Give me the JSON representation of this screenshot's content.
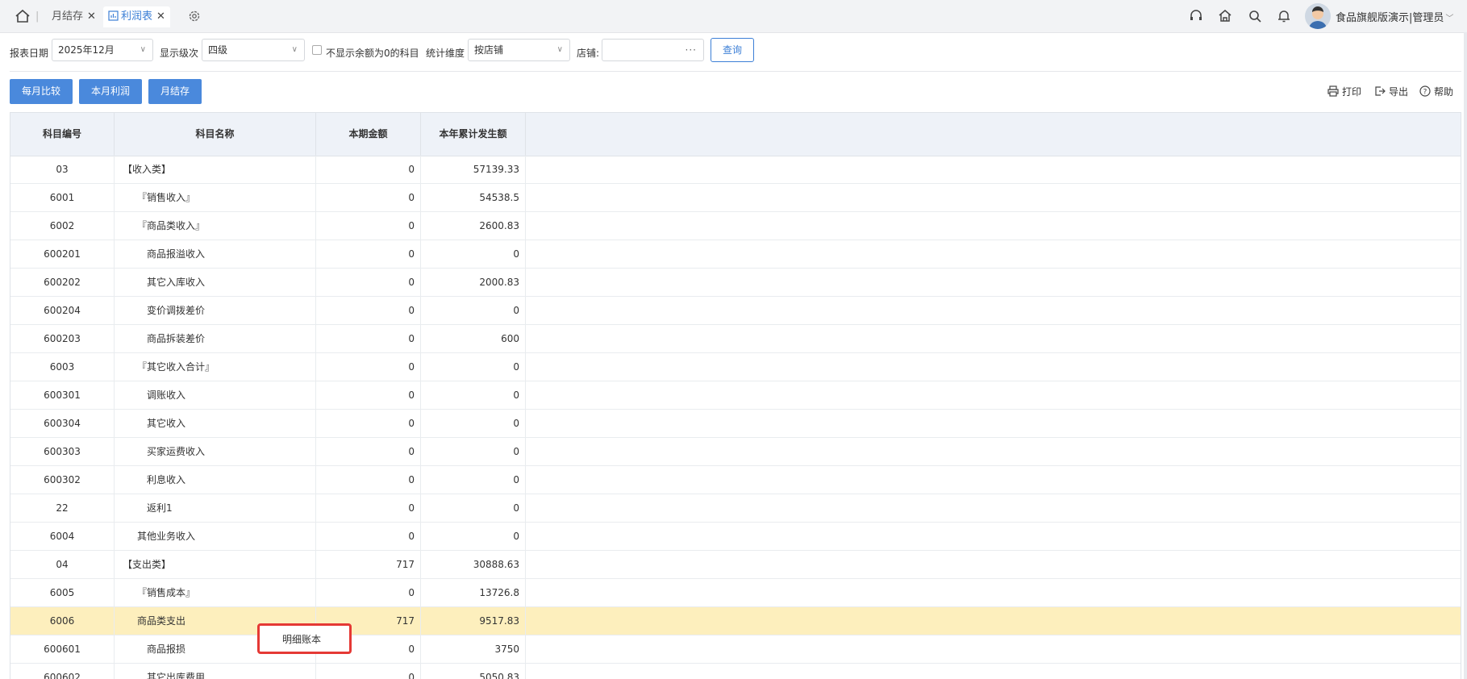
{
  "tabs": [
    {
      "label": "月结存"
    },
    {
      "label": "利润表"
    }
  ],
  "user": {
    "name": "食品旗舰版演示|管理员"
  },
  "filters": {
    "report_date_label": "报表日期",
    "report_date_value": "2025年12月",
    "level_label": "显示级次",
    "level_value": "四级",
    "hide_zero_label": "不显示余额为0的科目",
    "dimension_label": "统计维度",
    "dimension_value": "按店铺",
    "store_label": "店铺:",
    "store_value": "",
    "query_label": "查询"
  },
  "actions": {
    "monthly_compare": "每月比较",
    "this_month_profit": "本月利润",
    "month_end": "月结存",
    "print": "打印",
    "export": "导出",
    "help": "帮助"
  },
  "table": {
    "headers": [
      "科目编号",
      "科目名称",
      "本期金额",
      "本年累计发生额"
    ],
    "rows": [
      {
        "code": "03",
        "name": "【收入类】",
        "amount": "0",
        "ytd": "57139.33",
        "level": 0
      },
      {
        "code": "6001",
        "name": "『销售收入』",
        "amount": "0",
        "ytd": "54538.5",
        "level": 1
      },
      {
        "code": "6002",
        "name": "『商品类收入』",
        "amount": "0",
        "ytd": "2600.83",
        "level": 1
      },
      {
        "code": "600201",
        "name": "商品报溢收入",
        "amount": "0",
        "ytd": "0",
        "level": 2
      },
      {
        "code": "600202",
        "name": "其它入库收入",
        "amount": "0",
        "ytd": "2000.83",
        "level": 2
      },
      {
        "code": "600204",
        "name": "变价调拨差价",
        "amount": "0",
        "ytd": "0",
        "level": 2
      },
      {
        "code": "600203",
        "name": "商品拆装差价",
        "amount": "0",
        "ytd": "600",
        "level": 2
      },
      {
        "code": "6003",
        "name": "『其它收入合计』",
        "amount": "0",
        "ytd": "0",
        "level": 1
      },
      {
        "code": "600301",
        "name": "调账收入",
        "amount": "0",
        "ytd": "0",
        "level": 2
      },
      {
        "code": "600304",
        "name": "其它收入",
        "amount": "0",
        "ytd": "0",
        "level": 2
      },
      {
        "code": "600303",
        "name": "买家运费收入",
        "amount": "0",
        "ytd": "0",
        "level": 2
      },
      {
        "code": "600302",
        "name": "利息收入",
        "amount": "0",
        "ytd": "0",
        "level": 2
      },
      {
        "code": "22",
        "name": "返利1",
        "amount": "0",
        "ytd": "0",
        "level": 2
      },
      {
        "code": "6004",
        "name": "其他业务收入",
        "amount": "0",
        "ytd": "0",
        "level": 1
      },
      {
        "code": "04",
        "name": "【支出类】",
        "amount": "717",
        "ytd": "30888.63",
        "level": 0
      },
      {
        "code": "6005",
        "name": "『销售成本』",
        "amount": "0",
        "ytd": "13726.8",
        "level": 1
      },
      {
        "code": "6006",
        "name": "商品类支出",
        "amount": "717",
        "ytd": "9517.83",
        "level": 1,
        "highlight": true
      },
      {
        "code": "600601",
        "name": "商品报损",
        "amount": "0",
        "ytd": "3750",
        "level": 2
      },
      {
        "code": "600602",
        "name": "其它出库费用",
        "amount": "0",
        "ytd": "5050.83",
        "level": 2
      }
    ]
  },
  "context_menu": {
    "item": "明细账本"
  }
}
